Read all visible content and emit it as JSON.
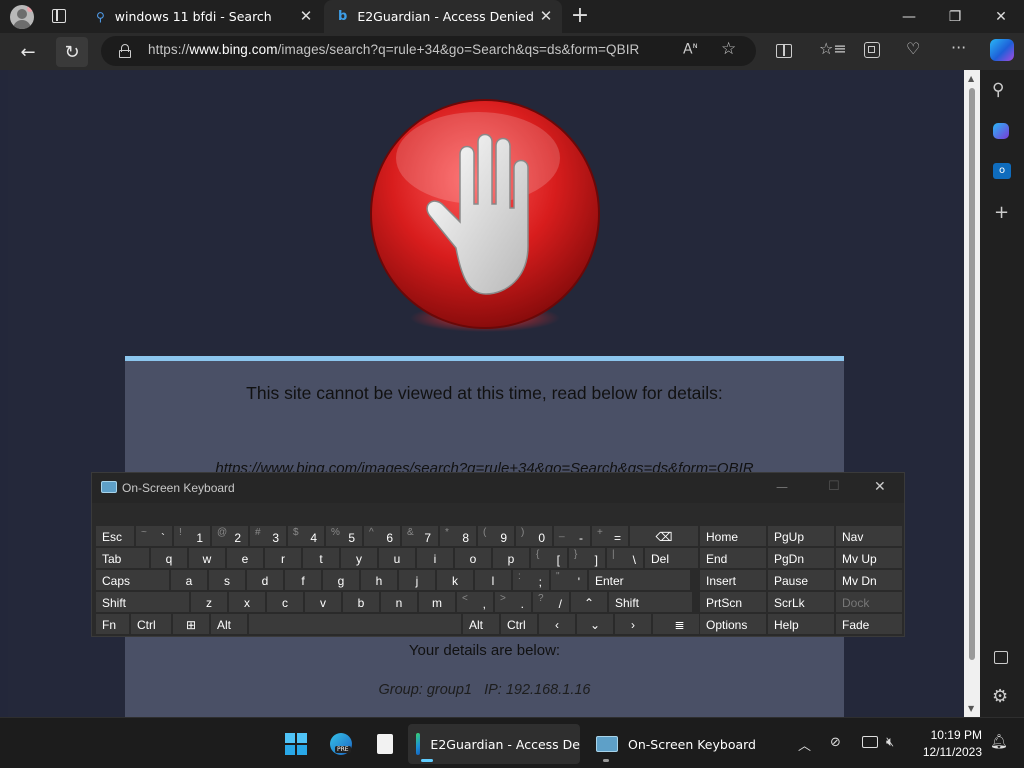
{
  "browser": {
    "tabs": [
      {
        "title": "windows 11 bfdi - Search",
        "close": "✕"
      },
      {
        "title": "E2Guardian - Access Denied",
        "close": "✕"
      }
    ],
    "new_tab": "+",
    "url_prefix": "https://",
    "url_domain": "www.bing.com",
    "url_rest": "/images/search?q=rule+34&go=Search&qs=ds&form=QBIR",
    "window_controls": {
      "minimize": "—",
      "restore": "❐",
      "close": "✕"
    }
  },
  "block_page": {
    "heading": "This site cannot be viewed at this time, read below for details:",
    "blocked_url": "https://www.bing.com/images/search?q=rule+34&go=Search&qs=ds&form=QBIR",
    "details_heading": "Your details are below:",
    "details_line": "Group: group1   IP: 192.168.1.16"
  },
  "osk": {
    "title": "On-Screen Keyboard",
    "controls": {
      "minimize": "—",
      "maximize": "☐",
      "close": "✕"
    },
    "rows": [
      [
        {
          "l": "Esc",
          "w": 40,
          "cls": "l"
        },
        {
          "t": "~",
          "b": "`"
        },
        {
          "t": "!",
          "b": "1"
        },
        {
          "t": "@",
          "b": "2"
        },
        {
          "t": "#",
          "b": "3"
        },
        {
          "t": "$",
          "b": "4"
        },
        {
          "t": "%",
          "b": "5"
        },
        {
          "t": "^",
          "b": "6"
        },
        {
          "t": "&",
          "b": "7"
        },
        {
          "t": "*",
          "b": "8"
        },
        {
          "t": "(",
          "b": "9"
        },
        {
          "t": ")",
          "b": "0"
        },
        {
          "t": "_",
          "b": "-"
        },
        {
          "t": "+",
          "b": "="
        },
        {
          "l": "⌫",
          "w": 70
        }
      ],
      [
        {
          "l": "Tab",
          "w": 55,
          "cls": "l"
        },
        {
          "l": "q"
        },
        {
          "l": "w"
        },
        {
          "l": "e"
        },
        {
          "l": "r"
        },
        {
          "l": "t"
        },
        {
          "l": "y"
        },
        {
          "l": "u"
        },
        {
          "l": "i"
        },
        {
          "l": "o"
        },
        {
          "l": "p"
        },
        {
          "t": "{",
          "b": "["
        },
        {
          "t": "}",
          "b": "]"
        },
        {
          "t": "|",
          "b": "\\"
        },
        {
          "l": "Del",
          "w": 55,
          "cls": "l"
        }
      ],
      [
        {
          "l": "Caps",
          "w": 75,
          "cls": "l"
        },
        {
          "l": "a"
        },
        {
          "l": "s"
        },
        {
          "l": "d"
        },
        {
          "l": "f"
        },
        {
          "l": "g"
        },
        {
          "l": "h"
        },
        {
          "l": "j"
        },
        {
          "l": "k"
        },
        {
          "l": "l"
        },
        {
          "t": ":",
          "b": ";"
        },
        {
          "t": "\"",
          "b": "'"
        },
        {
          "l": "Enter",
          "w": 103,
          "cls": "l"
        }
      ],
      [
        {
          "l": "Shift",
          "w": 95,
          "cls": "l"
        },
        {
          "l": "z"
        },
        {
          "l": "x"
        },
        {
          "l": "c"
        },
        {
          "l": "v"
        },
        {
          "l": "b"
        },
        {
          "l": "n"
        },
        {
          "l": "m"
        },
        {
          "t": "<",
          "b": ","
        },
        {
          "t": ">",
          "b": "."
        },
        {
          "t": "?",
          "b": "/"
        },
        {
          "l": "⌃"
        },
        {
          "l": "Shift",
          "w": 85,
          "cls": "l"
        }
      ],
      [
        {
          "l": "Fn",
          "w": 35,
          "cls": "l"
        },
        {
          "l": "Ctrl",
          "w": 42,
          "cls": "l"
        },
        {
          "l": "⊞",
          "w": 38
        },
        {
          "l": "Alt",
          "w": 38,
          "cls": "l"
        },
        {
          "l": "",
          "w": 214
        },
        {
          "l": "Alt",
          "w": 38,
          "cls": "l"
        },
        {
          "l": "Ctrl",
          "w": 38,
          "cls": "l"
        },
        {
          "l": "‹",
          "w": 38
        },
        {
          "l": "⌄",
          "w": 38
        },
        {
          "l": "›",
          "w": 38
        },
        {
          "l": "≣",
          "w": 55
        }
      ]
    ],
    "right_keys": [
      [
        "Home",
        "PgUp",
        "Nav"
      ],
      [
        "End",
        "PgDn",
        "Mv Up"
      ],
      [
        "Insert",
        "Pause",
        "Mv Dn"
      ],
      [
        "PrtScn",
        "ScrLk",
        "Dock"
      ],
      [
        "Options",
        "Help",
        "Fade"
      ]
    ]
  },
  "taskbar": {
    "edge_label": "E2Guardian - Access De",
    "osk_label": "On-Screen Keyboard",
    "time": "10:19 PM",
    "date": "12/11/2023",
    "edge_badge": "PRE"
  },
  "colors": {
    "accent": "#8cc6ee",
    "panel": "#4a5066",
    "page": "#24283a",
    "stop_red": "#d81d1d"
  }
}
